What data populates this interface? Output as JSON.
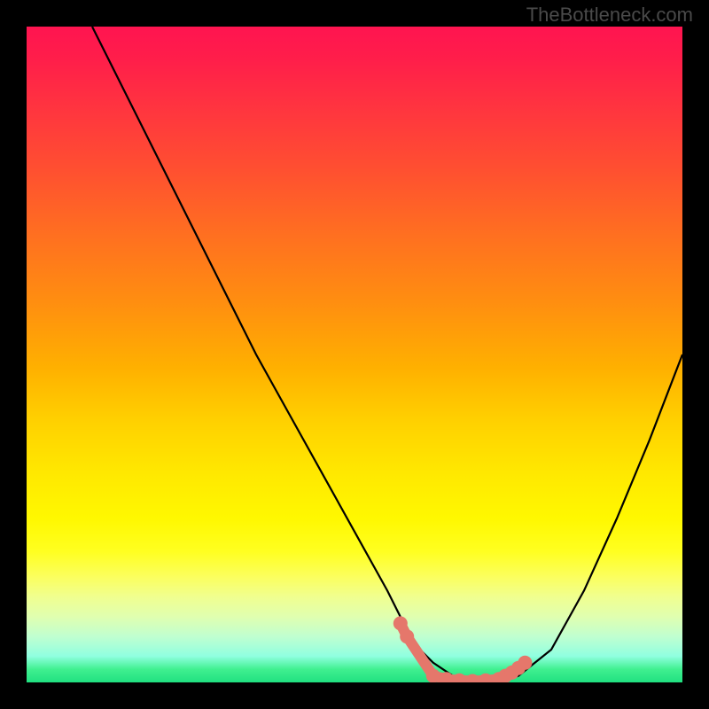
{
  "watermark": "TheBottleneck.com",
  "chart_data": {
    "type": "line",
    "title": "",
    "xlabel": "",
    "ylabel": "",
    "xlim": [
      0,
      100
    ],
    "ylim": [
      0,
      100
    ],
    "series": [
      {
        "name": "curve",
        "color": "#000000",
        "x": [
          10,
          15,
          20,
          25,
          30,
          35,
          40,
          45,
          50,
          55,
          58,
          60,
          62,
          65,
          68,
          70,
          72,
          75,
          80,
          85,
          90,
          95,
          100
        ],
        "y": [
          100,
          90,
          80,
          70,
          60,
          50,
          41,
          32,
          23,
          14,
          8,
          5,
          3,
          1,
          0,
          0,
          0,
          1,
          5,
          14,
          25,
          37,
          50
        ]
      },
      {
        "name": "markers",
        "color": "#e5776b",
        "type": "scatter",
        "x": [
          57,
          58,
          62,
          64,
          66,
          68,
          70,
          72,
          73,
          74,
          75,
          76
        ],
        "y": [
          9,
          7,
          1,
          0.5,
          0.3,
          0.2,
          0.3,
          0.5,
          1,
          1.5,
          2.2,
          3
        ]
      }
    ],
    "background": {
      "type": "vertical-gradient",
      "stops": [
        {
          "pos": 0,
          "color": "#ff1450"
        },
        {
          "pos": 50,
          "color": "#ffb000"
        },
        {
          "pos": 80,
          "color": "#ffff20"
        },
        {
          "pos": 100,
          "color": "#20e080"
        }
      ]
    }
  }
}
